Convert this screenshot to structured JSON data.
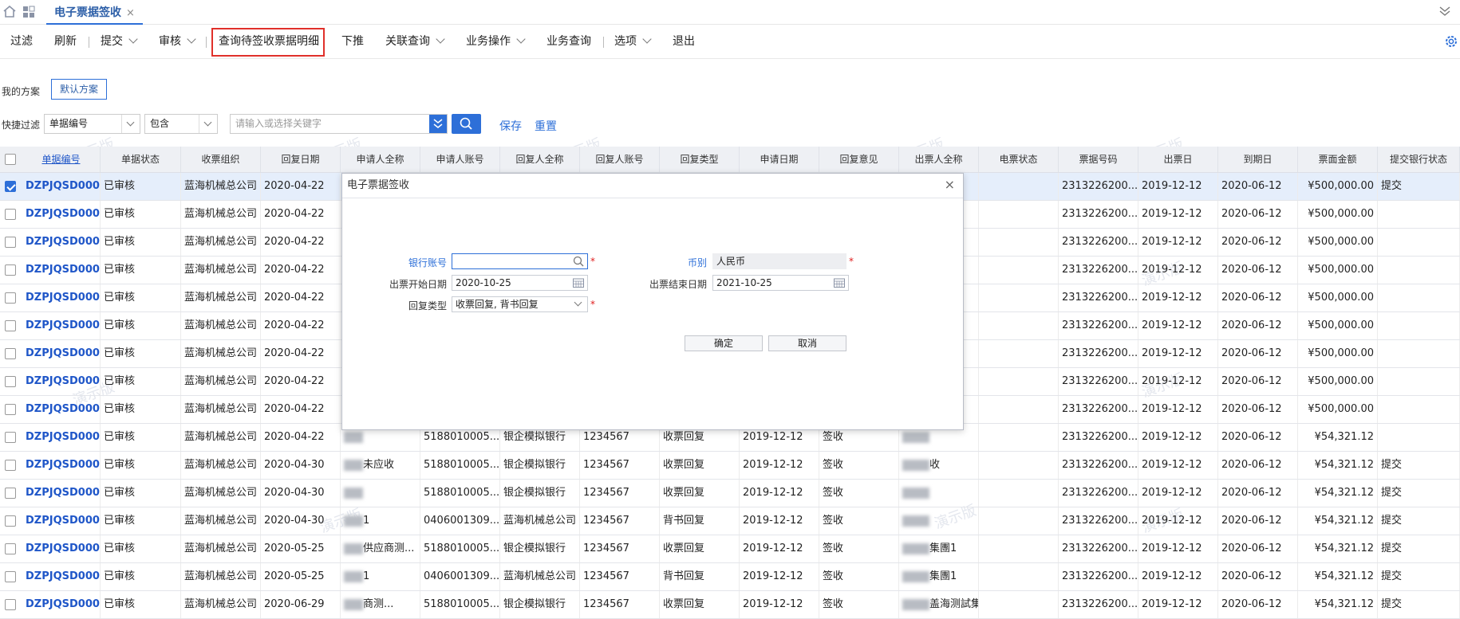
{
  "tabbar": {
    "tab_title": "电子票据签收",
    "close": "×"
  },
  "toolbar": {
    "items": [
      "过滤",
      "刷新",
      "提交",
      "审核",
      "查询待签收票据明细",
      "下推",
      "关联查询",
      "业务操作",
      "业务查询",
      "选项",
      "退出"
    ]
  },
  "scheme": {
    "label": "我的方案",
    "default_button": "默认方案"
  },
  "quickfilter": {
    "label": "快捷过滤",
    "field": "单据编号",
    "operator": "包含",
    "search_placeholder": "请输入或选择关键字",
    "save": "保存",
    "reset": "重置"
  },
  "watermark": "演示版",
  "table": {
    "headers": [
      "单据编号",
      "单据状态",
      "收票组织",
      "回复日期",
      "申请人全称",
      "申请人账号",
      "回复人全称",
      "回复人账号",
      "回复类型",
      "申请日期",
      "回复意见",
      "出票人全称",
      "电票状态",
      "票据号码",
      "出票日",
      "到期日",
      "票面金额",
      "提交银行状态"
    ],
    "rows": [
      {
        "no": "DZPJQSD000...",
        "status": "已审核",
        "org": "蓝海机械总公司",
        "date": "2020-04-22",
        "applicant": "",
        "acct": "",
        "replier": "",
        "replier_acct": "",
        "rtype": "",
        "adate": "",
        "opinion": "",
        "drawer": "",
        "estatus": "",
        "billno": "2313226200...",
        "issue": "2019-12-12",
        "due": "2020-06-12",
        "amount": "¥500,000.00",
        "bank": "提交",
        "checked": true
      },
      {
        "no": "DZPJQSD000...",
        "status": "已审核",
        "org": "蓝海机械总公司",
        "date": "2020-04-22",
        "applicant": "",
        "acct": "",
        "replier": "",
        "replier_acct": "",
        "rtype": "",
        "adate": "",
        "opinion": "",
        "drawer": "",
        "estatus": "",
        "billno": "2313226200...",
        "issue": "2019-12-12",
        "due": "2020-06-12",
        "amount": "¥500,000.00",
        "bank": ""
      },
      {
        "no": "DZPJQSD000...",
        "status": "已审核",
        "org": "蓝海机械总公司",
        "date": "2020-04-22",
        "applicant": "",
        "acct": "",
        "replier": "",
        "replier_acct": "",
        "rtype": "",
        "adate": "",
        "opinion": "",
        "drawer": "",
        "estatus": "",
        "billno": "2313226200...",
        "issue": "2019-12-12",
        "due": "2020-06-12",
        "amount": "¥500,000.00",
        "bank": ""
      },
      {
        "no": "DZPJQSD000...",
        "status": "已审核",
        "org": "蓝海机械总公司",
        "date": "2020-04-22",
        "applicant": "",
        "acct": "",
        "replier": "",
        "replier_acct": "",
        "rtype": "",
        "adate": "",
        "opinion": "",
        "drawer": "",
        "estatus": "",
        "billno": "2313226200...",
        "issue": "2019-12-12",
        "due": "2020-06-12",
        "amount": "¥500,000.00",
        "bank": ""
      },
      {
        "no": "DZPJQSD000...",
        "status": "已审核",
        "org": "蓝海机械总公司",
        "date": "2020-04-22",
        "applicant": "",
        "acct": "",
        "replier": "",
        "replier_acct": "",
        "rtype": "",
        "adate": "",
        "opinion": "",
        "drawer": "",
        "estatus": "",
        "billno": "2313226200...",
        "issue": "2019-12-12",
        "due": "2020-06-12",
        "amount": "¥500,000.00",
        "bank": ""
      },
      {
        "no": "DZPJQSD000...",
        "status": "已审核",
        "org": "蓝海机械总公司",
        "date": "2020-04-22",
        "applicant": "",
        "acct": "",
        "replier": "",
        "replier_acct": "",
        "rtype": "",
        "adate": "",
        "opinion": "",
        "drawer": "",
        "estatus": "",
        "billno": "2313226200...",
        "issue": "2019-12-12",
        "due": "2020-06-12",
        "amount": "¥500,000.00",
        "bank": ""
      },
      {
        "no": "DZPJQSD000...",
        "status": "已审核",
        "org": "蓝海机械总公司",
        "date": "2020-04-22",
        "applicant": "",
        "acct": "",
        "replier": "",
        "replier_acct": "",
        "rtype": "",
        "adate": "",
        "opinion": "",
        "drawer": "",
        "estatus": "",
        "billno": "2313226200...",
        "issue": "2019-12-12",
        "due": "2020-06-12",
        "amount": "¥500,000.00",
        "bank": ""
      },
      {
        "no": "DZPJQSD000...",
        "status": "已审核",
        "org": "蓝海机械总公司",
        "date": "2020-04-22",
        "applicant": "",
        "acct": "",
        "replier": "",
        "replier_acct": "",
        "rtype": "",
        "adate": "",
        "opinion": "",
        "drawer": "",
        "estatus": "",
        "billno": "2313226200...",
        "issue": "2019-12-12",
        "due": "2020-06-12",
        "amount": "¥500,000.00",
        "bank": ""
      },
      {
        "no": "DZPJQSD000...",
        "status": "已审核",
        "org": "蓝海机械总公司",
        "date": "2020-04-22",
        "applicant": "",
        "acct": "",
        "replier": "",
        "replier_acct": "",
        "rtype": "",
        "adate": "",
        "opinion": "",
        "drawer": "",
        "estatus": "",
        "billno": "2313226200...",
        "issue": "2019-12-12",
        "due": "2020-06-12",
        "amount": "¥500,000.00",
        "bank": ""
      },
      {
        "no": "DZPJQSD000...",
        "status": "已审核",
        "org": "蓝海机械总公司",
        "date": "2020-04-22",
        "applicant": "",
        "acct": "5188010005...",
        "replier": "银企模拟银行",
        "replier_acct": "1234567",
        "rtype": "收票回复",
        "adate": "2019-12-12",
        "opinion": "签收",
        "drawer": "",
        "estatus": "",
        "billno": "2313226200...",
        "issue": "2019-12-12",
        "due": "2020-06-12",
        "amount": "¥54,321.12",
        "bank": ""
      },
      {
        "no": "DZPJQSD000...",
        "status": "已审核",
        "org": "蓝海机械总公司",
        "date": "2020-04-30",
        "applicant": "未应收",
        "acct": "5188010005...",
        "replier": "银企模拟银行",
        "replier_acct": "1234567",
        "rtype": "收票回复",
        "adate": "2019-12-12",
        "opinion": "签收",
        "drawer": "收",
        "estatus": "",
        "billno": "2313226200...",
        "issue": "2019-12-12",
        "due": "2020-06-12",
        "amount": "¥54,321.12",
        "bank": "提交"
      },
      {
        "no": "DZPJQSD000...",
        "status": "已审核",
        "org": "蓝海机械总公司",
        "date": "2020-04-30",
        "applicant": "",
        "acct": "5188010005...",
        "replier": "银企模拟银行",
        "replier_acct": "1234567",
        "rtype": "收票回复",
        "adate": "2019-12-12",
        "opinion": "签收",
        "drawer": "",
        "estatus": "",
        "billno": "2313226200...",
        "issue": "2019-12-12",
        "due": "2020-06-12",
        "amount": "¥54,321.12",
        "bank": "提交"
      },
      {
        "no": "DZPJQSD000...",
        "status": "已审核",
        "org": "蓝海机械总公司",
        "date": "2020-04-30",
        "applicant": "1",
        "acct": "0406001309...",
        "replier": "蓝海机械总公司",
        "replier_acct": "1234567",
        "rtype": "背书回复",
        "adate": "2019-12-12",
        "opinion": "签收",
        "drawer": "",
        "estatus": "",
        "billno": "2313226200...",
        "issue": "2019-12-12",
        "due": "2020-06-12",
        "amount": "¥54,321.12",
        "bank": "提交"
      },
      {
        "no": "DZPJQSD000...",
        "status": "已审核",
        "org": "蓝海机械总公司",
        "date": "2020-05-25",
        "applicant": "供应商测...",
        "acct": "5188010005...",
        "replier": "银企模拟银行",
        "replier_acct": "1234567",
        "rtype": "收票回复",
        "adate": "2019-12-12",
        "opinion": "签收",
        "drawer": "集團1",
        "estatus": "",
        "billno": "2313226200...",
        "issue": "2019-12-12",
        "due": "2020-06-12",
        "amount": "¥54,321.12",
        "bank": "提交"
      },
      {
        "no": "DZPJQSD000...",
        "status": "已审核",
        "org": "蓝海机械总公司",
        "date": "2020-05-25",
        "applicant": "1",
        "acct": "0406001309...",
        "replier": "蓝海机械总公司",
        "replier_acct": "1234567",
        "rtype": "背书回复",
        "adate": "2019-12-12",
        "opinion": "签收",
        "drawer": "集團1",
        "estatus": "",
        "billno": "2313226200...",
        "issue": "2019-12-12",
        "due": "2020-06-12",
        "amount": "¥54,321.12",
        "bank": "提交"
      },
      {
        "no": "DZPJQSD000...",
        "status": "已审核",
        "org": "蓝海机械总公司",
        "date": "2020-06-29",
        "applicant": "商测...",
        "acct": "5188010005...",
        "replier": "银企模拟银行",
        "replier_acct": "1234567",
        "rtype": "收票回复",
        "adate": "2019-12-12",
        "opinion": "签收",
        "drawer": "盖海测試集團1",
        "estatus": "",
        "billno": "2313226200...",
        "issue": "2019-12-12",
        "due": "2020-06-12",
        "amount": "¥54,321.12",
        "bank": "提交"
      }
    ]
  },
  "dialog": {
    "title": "电子票据签收",
    "close": "×",
    "bank_account_label": "银行账号",
    "bank_account_value": "",
    "currency_label": "币别",
    "currency_value": "人民币",
    "start_date_label": "出票开始日期",
    "start_date_value": "2020-10-25",
    "end_date_label": "出票结束日期",
    "end_date_value": "2021-10-25",
    "reply_type_label": "回复类型",
    "reply_type_value": "收票回复, 背书回复",
    "required_mark": "*",
    "ok": "确定",
    "cancel": "取消"
  },
  "colors": {
    "accent": "#2d6fd8",
    "link": "#1f56c8",
    "highlight_border": "#e0302a",
    "header_bg": "#eef0f4",
    "selected_row": "#e5eefb"
  }
}
